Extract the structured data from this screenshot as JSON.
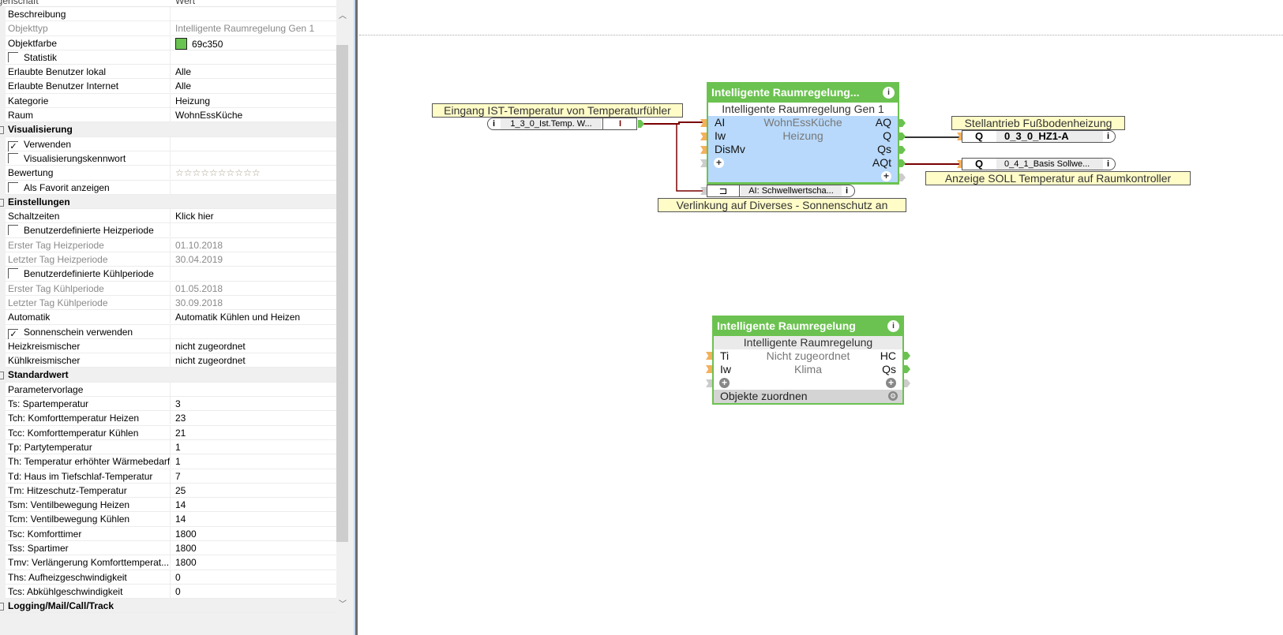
{
  "properties": {
    "header": {
      "name": "Eigenschaft",
      "value": "Wert"
    },
    "rows": [
      {
        "type": "row",
        "name": "Beschreibung",
        "value": ""
      },
      {
        "type": "row",
        "name": "Objekttyp",
        "value": "Intelligente Raumregelung Gen 1",
        "disabled": true
      },
      {
        "type": "color",
        "name": "Objektfarbe",
        "value": "69c350"
      },
      {
        "type": "check",
        "name": "Statistik",
        "checked": false
      },
      {
        "type": "row",
        "name": "Erlaubte Benutzer lokal",
        "value": "Alle"
      },
      {
        "type": "row",
        "name": "Erlaubte Benutzer Internet",
        "value": "Alle"
      },
      {
        "type": "row",
        "name": "Kategorie",
        "value": "Heizung"
      },
      {
        "type": "row",
        "name": "Raum",
        "value": "WohnEssKüche"
      },
      {
        "type": "section",
        "name": "Visualisierung"
      },
      {
        "type": "check",
        "name": "Verwenden",
        "checked": true
      },
      {
        "type": "check",
        "name": "Visualisierungskennwort",
        "checked": false
      },
      {
        "type": "stars",
        "name": "Bewertung",
        "value": "☆☆☆☆☆☆☆☆☆☆",
        "rating": 0
      },
      {
        "type": "check",
        "name": "Als Favorit anzeigen",
        "checked": false
      },
      {
        "type": "section",
        "name": "Einstellungen"
      },
      {
        "type": "row",
        "name": "Schaltzeiten",
        "value": "Klick hier"
      },
      {
        "type": "check",
        "name": "Benutzerdefinierte Heizperiode",
        "checked": false
      },
      {
        "type": "row",
        "name": "Erster Tag Heizperiode",
        "value": "01.10.2018",
        "disabled": true
      },
      {
        "type": "row",
        "name": "Letzter Tag Heizperiode",
        "value": "30.04.2019",
        "disabled": true
      },
      {
        "type": "check",
        "name": "Benutzerdefinierte Kühlperiode",
        "checked": false
      },
      {
        "type": "row",
        "name": "Erster Tag Kühlperiode",
        "value": "01.05.2018",
        "disabled": true
      },
      {
        "type": "row",
        "name": "Letzter Tag Kühlperiode",
        "value": "30.09.2018",
        "disabled": true
      },
      {
        "type": "row",
        "name": "Automatik",
        "value": "Automatik Kühlen und Heizen"
      },
      {
        "type": "check",
        "name": "Sonnenschein verwenden",
        "checked": true
      },
      {
        "type": "row",
        "name": "Heizkreismischer",
        "value": "nicht zugeordnet"
      },
      {
        "type": "row",
        "name": "Kühlkreismischer",
        "value": "nicht zugeordnet"
      },
      {
        "type": "section",
        "name": "Standardwert"
      },
      {
        "type": "row",
        "name": "Parametervorlage",
        "value": ""
      },
      {
        "type": "row",
        "name": "Ts: Spartemperatur",
        "value": "3"
      },
      {
        "type": "row",
        "name": "Tch: Komforttemperatur Heizen",
        "value": "23"
      },
      {
        "type": "row",
        "name": "Tcc: Komforttemperatur Kühlen",
        "value": "21"
      },
      {
        "type": "row",
        "name": "Tp: Partytemperatur",
        "value": "1"
      },
      {
        "type": "row",
        "name": "Th: Temperatur erhöhter Wärmebedarf",
        "value": "1"
      },
      {
        "type": "row",
        "name": "Td: Haus im Tiefschlaf-Temperatur",
        "value": "7"
      },
      {
        "type": "row",
        "name": "Tm: Hitzeschutz-Temperatur",
        "value": "25"
      },
      {
        "type": "row",
        "name": "Tsm: Ventilbewegung Heizen",
        "value": "14"
      },
      {
        "type": "row",
        "name": "Tcm: Ventilbewegung Kühlen",
        "value": "14"
      },
      {
        "type": "row",
        "name": "Tsc: Komforttimer",
        "value": "1800"
      },
      {
        "type": "row",
        "name": "Tss: Spartimer",
        "value": "1800"
      },
      {
        "type": "row",
        "name": "Tmv: Verlängerung Komforttemperat...",
        "value": "1800"
      },
      {
        "type": "row",
        "name": "Ths: Aufheizgeschwindigkeit",
        "value": "0"
      },
      {
        "type": "row",
        "name": "Tcs: Abkühlgeschwindigkeit",
        "value": "0"
      },
      {
        "type": "section",
        "name": "Logging/Mail/Call/Track"
      }
    ]
  },
  "canvas": {
    "block1": {
      "title": "Intelligente  Raumregelung...",
      "subtitle": "Intelligente Raumregelung Gen 1",
      "room": "WohnEssKüche",
      "category": "Heizung",
      "inputs": [
        "AI",
        "Iw",
        "DisMv"
      ],
      "outputs": [
        "AQ",
        "Q",
        "Qs",
        "AQt"
      ],
      "link": "AI: Schwellwertscha..."
    },
    "block2": {
      "title": "Intelligente Raumregelung",
      "subtitle": "Intelligente Raumregelung",
      "room": "Nicht zugeordnet",
      "category": "Klima",
      "inputs": [
        "Ti",
        "Iw"
      ],
      "outputs": [
        "HC",
        "Qs"
      ],
      "footer": "Objekte zuordnen"
    },
    "input_obj": {
      "name": "1_3_0_Ist.Temp.  W...",
      "value": "I"
    },
    "out1": {
      "type": "Q",
      "name": "0_3_0_HZ1-A"
    },
    "out2": {
      "type": "Q",
      "name": "0_4_1_Basis  Sollwe..."
    },
    "labels": {
      "input": "Eingang IST-Temperatur von Temperaturfühler",
      "out1": "Stellantrieb Fußbodenheizung",
      "out2": "Anzeige SOLL Temperatur auf Raumkontroller",
      "link": "Verlinkung auf Diverses - Sonnenschutz an"
    }
  },
  "colors": {
    "block": "#69c350",
    "wire_red": "#7a0000",
    "wire_dark": "#333333"
  }
}
